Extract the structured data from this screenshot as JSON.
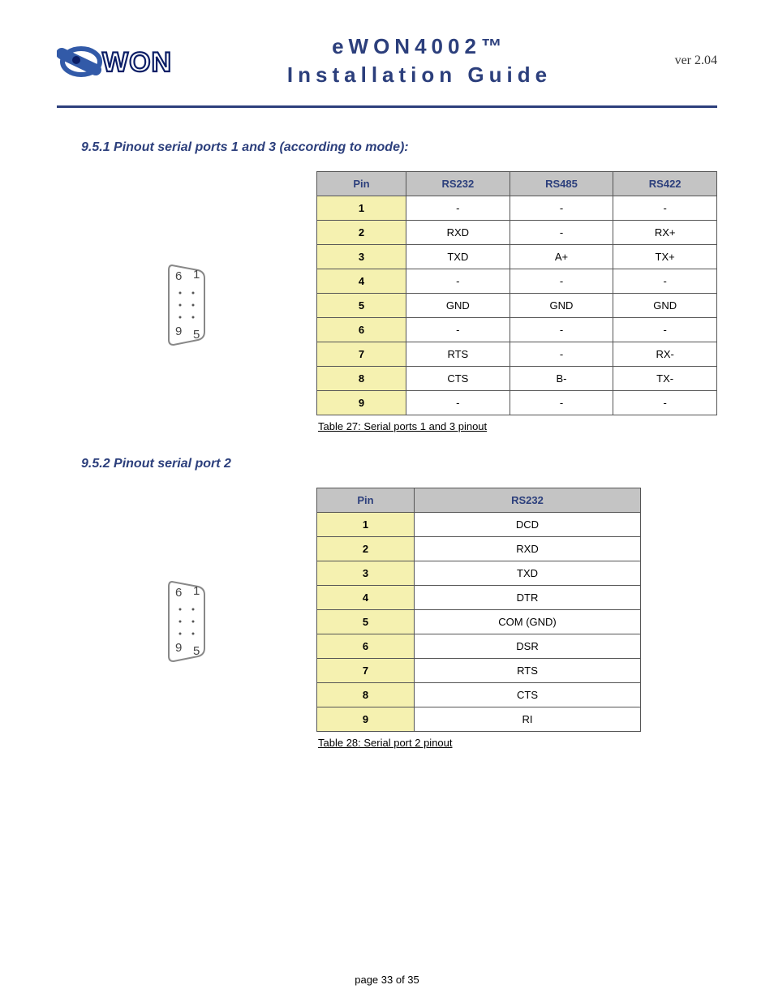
{
  "header": {
    "title_line1": "eWON4002™",
    "title_line2": "Installation Guide",
    "version": "ver 2.04",
    "logo_name": "ewon-logo"
  },
  "section1": {
    "heading": "9.5.1 Pinout serial ports 1 and 3 (according to mode):",
    "connector": {
      "top_left": "6",
      "top_right": "1",
      "bottom_left": "9",
      "bottom_right": "5"
    },
    "table": {
      "headers": [
        "Pin",
        "RS232",
        "RS485",
        "RS422"
      ],
      "rows": [
        [
          "1",
          "-",
          "-",
          "-"
        ],
        [
          "2",
          "RXD",
          "-",
          "RX+"
        ],
        [
          "3",
          "TXD",
          "A+",
          "TX+"
        ],
        [
          "4",
          "-",
          "-",
          "-"
        ],
        [
          "5",
          "GND",
          "GND",
          "GND"
        ],
        [
          "6",
          "-",
          "-",
          "-"
        ],
        [
          "7",
          "RTS",
          "-",
          "RX-"
        ],
        [
          "8",
          "CTS",
          "B-",
          "TX-"
        ],
        [
          "9",
          "-",
          "-",
          "-"
        ]
      ]
    },
    "caption": "Table 27: Serial ports 1 and 3 pinout"
  },
  "section2": {
    "heading": "9.5.2 Pinout serial port 2",
    "connector": {
      "top_left": "6",
      "top_right": "1",
      "bottom_left": "9",
      "bottom_right": "5"
    },
    "table": {
      "headers": [
        "Pin",
        "RS232"
      ],
      "rows": [
        [
          "1",
          "DCD"
        ],
        [
          "2",
          "RXD"
        ],
        [
          "3",
          "TXD"
        ],
        [
          "4",
          "DTR"
        ],
        [
          "5",
          "COM (GND)"
        ],
        [
          "6",
          "DSR"
        ],
        [
          "7",
          "RTS"
        ],
        [
          "8",
          "CTS"
        ],
        [
          "9",
          "RI"
        ]
      ]
    },
    "caption": "Table 28: Serial port 2 pinout"
  },
  "footer": {
    "page_label": "page 33 of 35"
  }
}
